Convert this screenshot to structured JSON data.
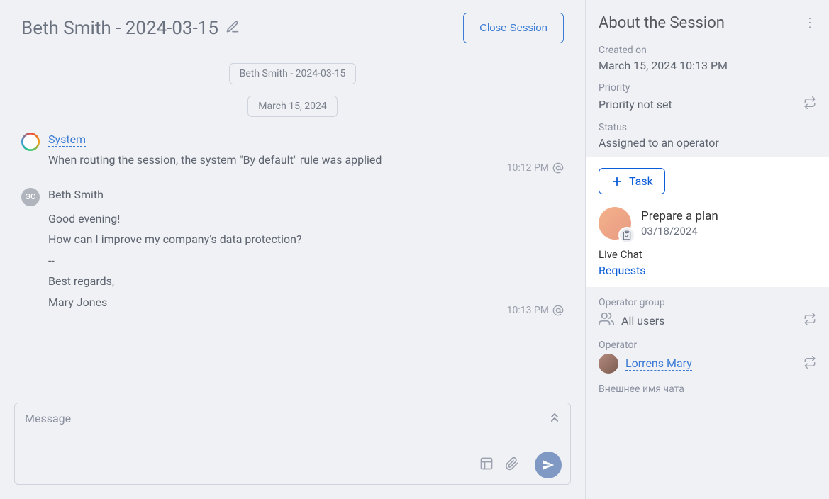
{
  "header": {
    "title": "Beth Smith - 2024-03-15",
    "close_label": "Close Session"
  },
  "chat": {
    "thread_chip": "Beth Smith - 2024-03-15",
    "date_chip": "March 15, 2024",
    "messages": [
      {
        "sender": "System",
        "sender_link": true,
        "avatar_kind": "ring",
        "body": "When routing the session, the system \"By default\" rule was applied",
        "time": "10:12 PM"
      },
      {
        "sender": "Beth Smith",
        "sender_link": false,
        "avatar_kind": "bs",
        "avatar_initials": "ЭС",
        "body": "Good evening!\nHow can I improve my company's data protection?\n--\nBest regards,\nMary Jones",
        "time": "10:13 PM"
      }
    ],
    "composer_placeholder": "Message"
  },
  "sidebar": {
    "title": "About the Session",
    "created_label": "Created on",
    "created_value": "March 15, 2024 10:13 PM",
    "priority_label": "Priority",
    "priority_value": "Priority not set",
    "status_label": "Status",
    "status_value": "Assigned to an operator",
    "add_task_label": "Task",
    "task": {
      "title": "Prepare a plan",
      "date": "03/18/2024"
    },
    "live_chat_label": "Live Chat",
    "requests_link": "Requests",
    "operator_group_label": "Operator group",
    "operator_group_value": "All users",
    "operator_label": "Operator",
    "operator_name": "Lorrens Mary",
    "external_name_label": "Внешнее имя чата"
  }
}
